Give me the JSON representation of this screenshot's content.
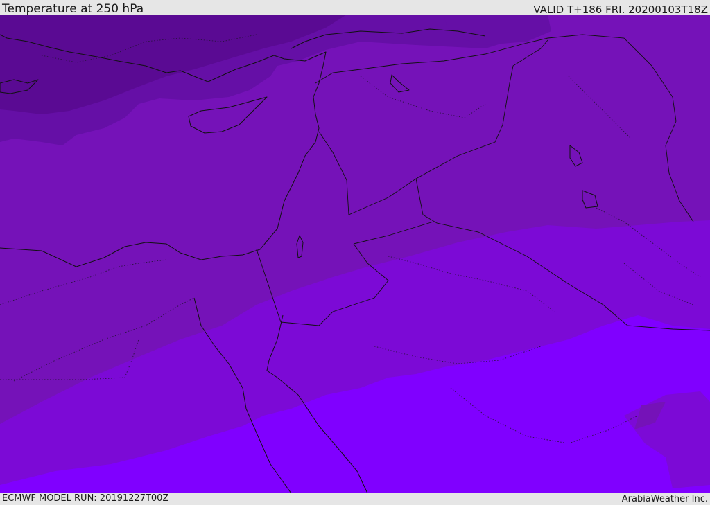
{
  "header": {
    "title": "Temperature at 250 hPa",
    "valid": "VALID T+186 FRI. 20200103T18Z"
  },
  "footer": {
    "model_run": "ECMWF MODEL RUN: 20191227T00Z",
    "credit": "ArabiaWeather Inc."
  },
  "colors": {
    "band_darkest": "#5a0a93",
    "band_dark": "#650fa6",
    "band_mid": "#7512b8",
    "band_violet": "#7c0ad6",
    "band_bright": "#8000ff",
    "band_light_violet": "#8a10f0",
    "coastline": "#111111",
    "bar_background": "#e6e6e6"
  }
}
